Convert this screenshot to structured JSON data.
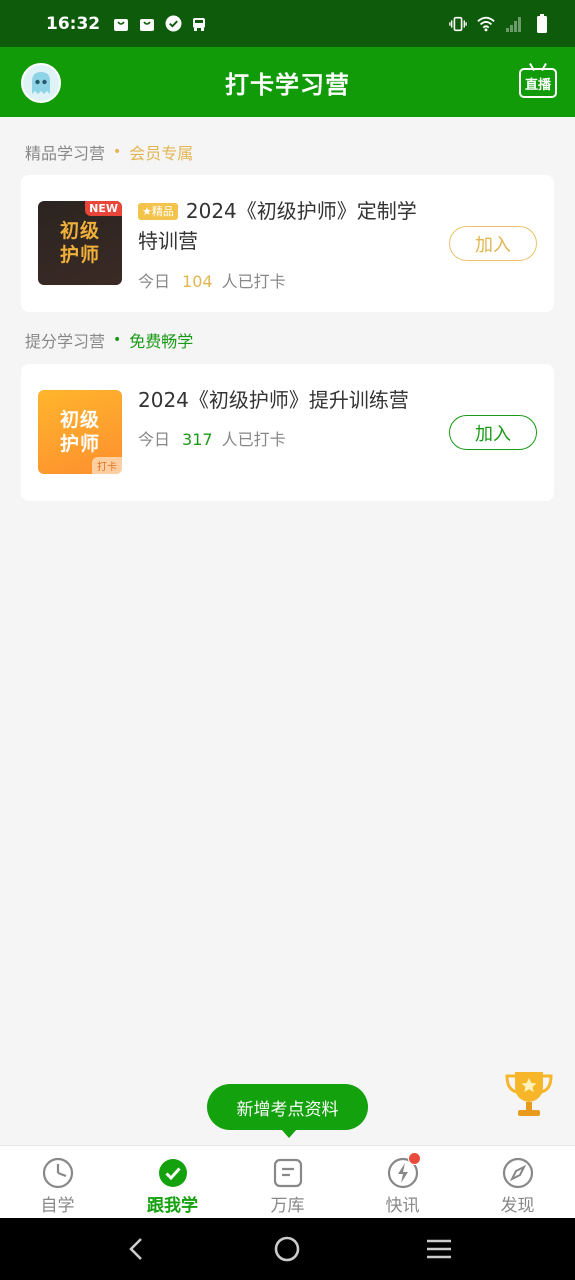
{
  "status_bar": {
    "time": "16:32",
    "icons": [
      "shopping-bag-icon",
      "shopping-bag-icon",
      "check-circle-icon",
      "bus-icon"
    ],
    "right_icons": [
      "vibrate-icon",
      "wifi-icon",
      "signal-icon",
      "battery-icon"
    ]
  },
  "header": {
    "title": "打卡学习营",
    "live_label": "直播"
  },
  "sections": [
    {
      "label": "精品学习营",
      "tag": "会员专属",
      "card": {
        "thumb_text": "初级护师",
        "badge": "NEW",
        "tag": "★精品",
        "title": "2024《初级护师》定制学特训营",
        "meta_prefix": "今日",
        "count": "104",
        "meta_suffix": "人已打卡",
        "button": "加入"
      }
    },
    {
      "label": "提分学习营",
      "tag": "免费畅学",
      "card": {
        "thumb_text": "初级护师",
        "badge": "打卡",
        "title": "2024《初级护师》提升训练营",
        "meta_prefix": "今日",
        "count": "317",
        "meta_suffix": "人已打卡",
        "button": "加入"
      }
    }
  ],
  "tip_bubble": "新增考点资料",
  "bottom_nav": [
    {
      "label": "自学",
      "icon": "self-study-icon",
      "active": false
    },
    {
      "label": "跟我学",
      "icon": "check-circle-icon",
      "active": true
    },
    {
      "label": "万库",
      "icon": "library-icon",
      "active": false
    },
    {
      "label": "快讯",
      "icon": "lightning-icon",
      "active": false,
      "dot": true
    },
    {
      "label": "发现",
      "icon": "compass-icon",
      "active": false
    }
  ],
  "colors": {
    "status_bar": "#0e5c0b",
    "header": "#119b08",
    "accent_green": "#1a9a17",
    "gold": "#e3b552"
  }
}
